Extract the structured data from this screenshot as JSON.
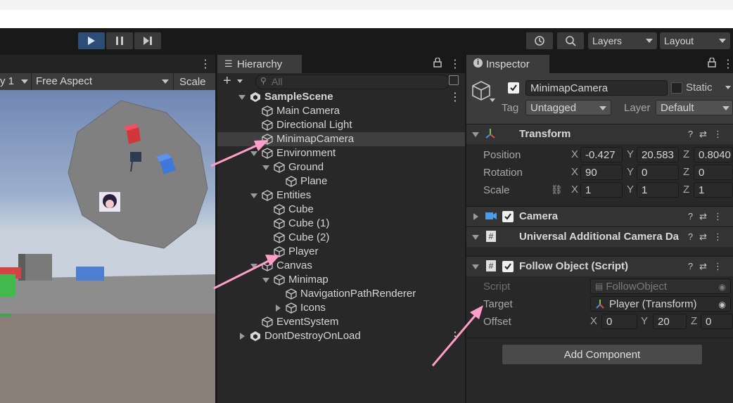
{
  "toolbar": {
    "layers_label": "Layers",
    "layout_label": "Layout"
  },
  "game": {
    "display_label": "y 1",
    "aspect_label": "Free Aspect",
    "scale_label": "Scale"
  },
  "hierarchy": {
    "tab_label": "Hierarchy",
    "search_placeholder": "All",
    "items": [
      {
        "label": "SampleScene",
        "indent": 0,
        "fold": "down",
        "scene": true
      },
      {
        "label": "Main Camera",
        "indent": 1,
        "fold": ""
      },
      {
        "label": "Directional Light",
        "indent": 1,
        "fold": ""
      },
      {
        "label": "MinimapCamera",
        "indent": 1,
        "fold": "",
        "selected": true
      },
      {
        "label": "Environment",
        "indent": 1,
        "fold": "down"
      },
      {
        "label": "Ground",
        "indent": 2,
        "fold": "down"
      },
      {
        "label": "Plane",
        "indent": 3,
        "fold": ""
      },
      {
        "label": "Entities",
        "indent": 1,
        "fold": "down"
      },
      {
        "label": "Cube",
        "indent": 2,
        "fold": ""
      },
      {
        "label": "Cube (1)",
        "indent": 2,
        "fold": ""
      },
      {
        "label": "Cube (2)",
        "indent": 2,
        "fold": ""
      },
      {
        "label": "Player",
        "indent": 2,
        "fold": ""
      },
      {
        "label": "Canvas",
        "indent": 1,
        "fold": "down"
      },
      {
        "label": "Minimap",
        "indent": 2,
        "fold": "down"
      },
      {
        "label": "NavigationPathRenderer",
        "indent": 3,
        "fold": ""
      },
      {
        "label": "Icons",
        "indent": 3,
        "fold": "right"
      },
      {
        "label": "EventSystem",
        "indent": 1,
        "fold": ""
      },
      {
        "label": "DontDestroyOnLoad",
        "indent": 0,
        "fold": "right",
        "scene": true
      }
    ]
  },
  "inspector": {
    "tab_label": "Inspector",
    "object_name": "MinimapCamera",
    "static_label": "Static",
    "tag_label": "Tag",
    "tag_value": "Untagged",
    "layer_label": "Layer",
    "layer_value": "Default",
    "transform": {
      "title": "Transform",
      "position_label": "Position",
      "rotation_label": "Rotation",
      "scale_label": "Scale",
      "position": {
        "x": "-0.427",
        "y": "20.583",
        "z": "0.8040"
      },
      "rotation": {
        "x": "90",
        "y": "0",
        "z": "0"
      },
      "scale": {
        "x": "1",
        "y": "1",
        "z": "1"
      }
    },
    "camera_title": "Camera",
    "urp_title": "Universal Additional Camera Da",
    "follow": {
      "title": "Follow Object (Script)",
      "script_label": "Script",
      "script_value": "FollowObject",
      "target_label": "Target",
      "target_value": "Player (Transform)",
      "offset_label": "Offset",
      "offset": {
        "x": "0",
        "y": "20",
        "z": "0"
      }
    },
    "add_component_label": "Add Component"
  },
  "axis_labels": {
    "x": "X",
    "y": "Y",
    "z": "Z"
  },
  "colors": {
    "accent_arrow": "#ff9ec8",
    "play_active": "#2c4d76"
  }
}
